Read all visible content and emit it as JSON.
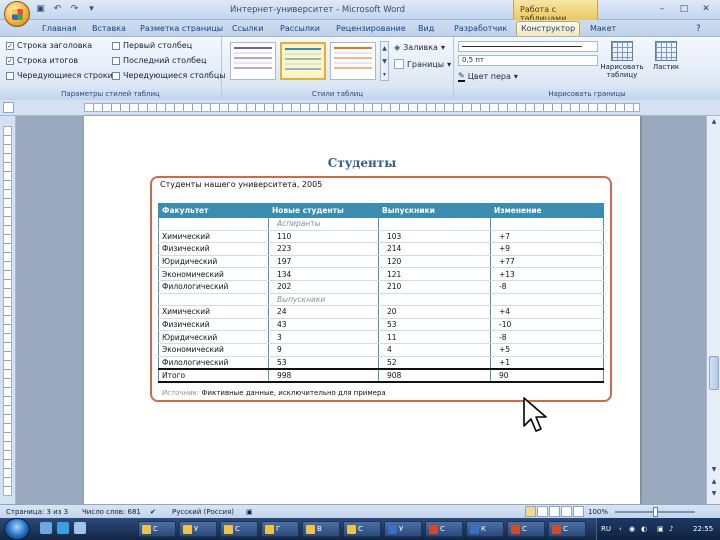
{
  "window": {
    "title": "Интернет-университет - Microsoft Word",
    "context_tab_group": "Работа с таблицами"
  },
  "tabs": [
    {
      "label": "Главная",
      "active": false
    },
    {
      "label": "Вставка",
      "active": false
    },
    {
      "label": "Разметка страницы",
      "active": false
    },
    {
      "label": "Ссылки",
      "active": false
    },
    {
      "label": "Рассылки",
      "active": false
    },
    {
      "label": "Рецензирование",
      "active": false
    },
    {
      "label": "Вид",
      "active": false
    },
    {
      "label": "Разработчик",
      "active": false
    },
    {
      "label": "Конструктор",
      "active": true
    },
    {
      "label": "Макет",
      "active": false
    }
  ],
  "ribbon": {
    "style_options": {
      "label": "Параметры стилей таблиц",
      "options": [
        {
          "label": "Строка заголовка",
          "checked": true
        },
        {
          "label": "Строка итогов",
          "checked": true
        },
        {
          "label": "Чередующиеся строки",
          "checked": false
        },
        {
          "label": "Первый столбец",
          "checked": false
        },
        {
          "label": "Последний столбец",
          "checked": false
        },
        {
          "label": "Чередующиеся столбцы",
          "checked": false
        }
      ]
    },
    "table_styles": {
      "label": "Стили таблиц",
      "fill_label": "Заливка",
      "borders_label": "Границы",
      "swatches": [
        {
          "accent": "#7b5ea8",
          "selected": false
        },
        {
          "accent": "#3a8db0",
          "selected": true
        },
        {
          "accent": "#e07a2a",
          "selected": false
        }
      ]
    },
    "draw_borders": {
      "label": "Нарисовать границы",
      "line_weight": "0,5 пт",
      "pen_color_label": "Цвет пера",
      "draw_table_label": "Нарисовать таблицу",
      "eraser_label": "Ластик"
    }
  },
  "document": {
    "heading": "Студенты",
    "table_caption": "Студенты нашего университета, 2005",
    "columns": [
      "Факультет",
      "Новые студенты",
      "Выпускники",
      "Изменение"
    ],
    "rows": [
      {
        "type": "group",
        "cells": [
          "",
          "Аспиранты",
          "",
          ""
        ]
      },
      {
        "type": "data",
        "cells": [
          "Химический",
          "110",
          "103",
          "+7"
        ]
      },
      {
        "type": "data",
        "cells": [
          "Физический",
          "223",
          "214",
          "+9"
        ]
      },
      {
        "type": "data",
        "cells": [
          "Юридический",
          "197",
          "120",
          "+77"
        ]
      },
      {
        "type": "data",
        "cells": [
          "Экономический",
          "134",
          "121",
          "+13"
        ]
      },
      {
        "type": "data",
        "cells": [
          "Филологический",
          "202",
          "210",
          "-8"
        ]
      },
      {
        "type": "group",
        "cells": [
          "",
          "Выпускники",
          "",
          ""
        ]
      },
      {
        "type": "data",
        "cells": [
          "Химический",
          "24",
          "20",
          "+4"
        ]
      },
      {
        "type": "data",
        "cells": [
          "Физический",
          "43",
          "53",
          "-10"
        ]
      },
      {
        "type": "data",
        "cells": [
          "Юридический",
          "3",
          "11",
          "-8"
        ]
      },
      {
        "type": "data",
        "cells": [
          "Экономический",
          "9",
          "4",
          "+5"
        ]
      },
      {
        "type": "data",
        "cells": [
          "Филологический",
          "53",
          "52",
          "+1"
        ]
      }
    ],
    "total_row": [
      "Итого",
      "998",
      "908",
      "90"
    ],
    "source_label": "Источник:",
    "source_text": "Фиктивные данные, исключительно для примера"
  },
  "statusbar": {
    "page": "Страница: 3 из 3",
    "words": "Число слов: 681",
    "language": "Русский (Россия)",
    "zoom": "100%"
  },
  "taskbar": {
    "tasks": [
      {
        "label": "С",
        "kind": "folder"
      },
      {
        "label": "У",
        "kind": "folder"
      },
      {
        "label": "С",
        "kind": "folder"
      },
      {
        "label": "Г",
        "kind": "folder"
      },
      {
        "label": "В",
        "kind": "folder"
      },
      {
        "label": "С",
        "kind": "folder"
      },
      {
        "label": "У",
        "kind": "word"
      },
      {
        "label": "С",
        "kind": "ppt"
      },
      {
        "label": "К",
        "kind": "word"
      },
      {
        "label": "С",
        "kind": "ppt"
      },
      {
        "label": "С",
        "kind": "ppt"
      }
    ],
    "lang": "RU",
    "clock": "22:55"
  }
}
